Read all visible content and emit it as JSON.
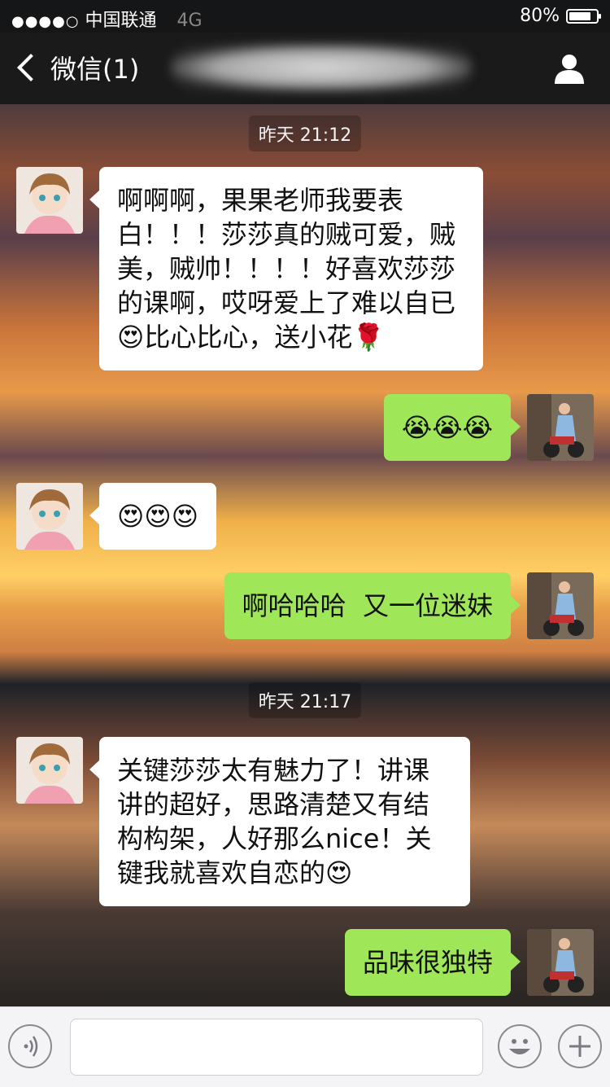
{
  "status_bar": {
    "signal_dots": "●●●●○",
    "carrier": "中国联通",
    "network": "4G",
    "battery_percent": "80%",
    "battery_level": 0.8
  },
  "nav": {
    "back_label": "微信(1)"
  },
  "messages": [
    {
      "time": "昨天 21:12"
    },
    {
      "direction": "in",
      "text": "啊啊啊，果果老师我要表白！！！莎莎真的贼可爱，贼美，贼帅！！！！好喜欢莎莎的课啊，哎呀爱上了难以自已😍比心比心，送小花🌹"
    },
    {
      "direction": "out",
      "text": "😭😭😭"
    },
    {
      "direction": "in",
      "text": "😍😍😍"
    },
    {
      "direction": "out",
      "text": "啊哈哈哈  又一位迷妹"
    },
    {
      "time": "昨天 21:17"
    },
    {
      "direction": "in",
      "text": "关键莎莎太有魅力了！讲课讲的超好，思路清楚又有结构构架，人好那么nice！关键我就喜欢自恋的😍"
    },
    {
      "direction": "out",
      "text": "品味很独特"
    }
  ]
}
